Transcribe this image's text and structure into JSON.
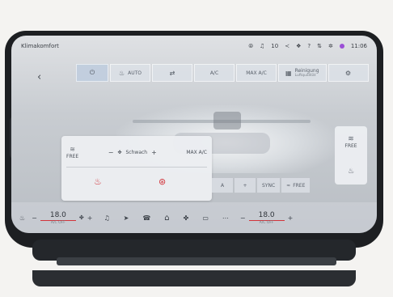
{
  "topbar": {
    "title": "Klimakomfort",
    "status": [
      "⦾",
      "♫",
      "10",
      "≺",
      "❖",
      "?",
      "⇅",
      "✲"
    ],
    "time": "11:06",
    "accent": "#9b4fd6"
  },
  "tabs": [
    {
      "icon": "power-icon",
      "label": ""
    },
    {
      "icon": "seat-air-icon",
      "label": "AUTO"
    },
    {
      "icon": "recirculation-icon",
      "label": ""
    },
    {
      "icon": "",
      "label": "A/C"
    },
    {
      "icon": "",
      "label": "MAX A/C"
    },
    {
      "icon": "cleaning-icon",
      "label": "Reinigung",
      "sub": "Luftqualität"
    },
    {
      "icon": "settings-icon",
      "label": ""
    }
  ],
  "panel": {
    "free_label": "FREE",
    "fan_label": "Schwach",
    "max_ac": "MAX A/C"
  },
  "mid_row": {
    "minus": "A",
    "plus": "+",
    "sync": "SYNC",
    "free": "FREE"
  },
  "right_panel": {
    "free": "FREE"
  },
  "bottombar": {
    "left_temp": "18.0",
    "left_sub": "A/C OFF",
    "right_temp": "18.0",
    "right_sub": "A/C OFF"
  },
  "colors": {
    "heat": "#d2343b",
    "screen": "#c8ccd1",
    "bezel": "#1d1f22"
  }
}
